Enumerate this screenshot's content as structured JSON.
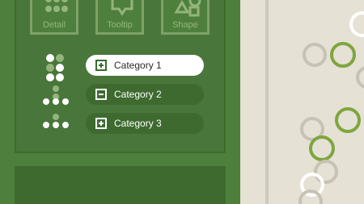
{
  "toolbar": {
    "buttons": [
      {
        "label": "Detail",
        "icon": "detail-dots-icon"
      },
      {
        "label": "Tooltip",
        "icon": "tooltip-icon"
      },
      {
        "label": "Shape",
        "icon": "shapes-icon"
      }
    ]
  },
  "categories": [
    {
      "label": "Category 1",
      "state": "expanded-selected",
      "icon": "plus-box-icon"
    },
    {
      "label": "Category 2",
      "state": "collapsed",
      "icon": "minus-box-icon"
    },
    {
      "label": "Category 3",
      "state": "collapsed",
      "icon": "plus-box-icon"
    }
  ],
  "colors": {
    "panel_green": "#4f7f3c",
    "dark_green": "#3e6a30",
    "accent_green": "#7ea63e",
    "background": "#e6e1d5",
    "ring_gray": "#c7c2b6"
  }
}
